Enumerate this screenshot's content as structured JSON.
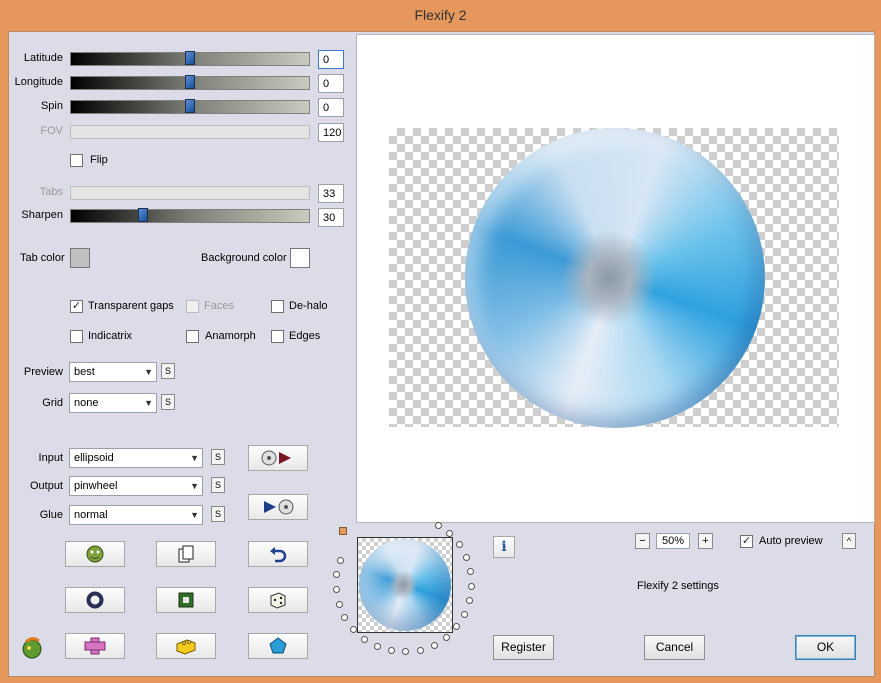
{
  "window": {
    "title": "Flexify 2"
  },
  "sliders": {
    "latitude": {
      "label": "Latitude",
      "value": "0",
      "fraction": 0.5
    },
    "longitude": {
      "label": "Longitude",
      "value": "0",
      "fraction": 0.5
    },
    "spin": {
      "label": "Spin",
      "value": "0",
      "fraction": 0.5
    },
    "fov": {
      "label": "FOV",
      "value": "120"
    },
    "tabs": {
      "label": "Tabs",
      "value": "33"
    },
    "sharpen": {
      "label": "Sharpen",
      "value": "30",
      "fraction": 0.3
    }
  },
  "flip": {
    "label": "Flip",
    "checked": false
  },
  "colors": {
    "tab_color": {
      "label": "Tab color",
      "color": "#c0c0c0"
    },
    "background_color": {
      "label": "Background color",
      "color": "#ffffff"
    }
  },
  "options": {
    "transparent_gaps": {
      "label": "Transparent gaps",
      "checked": true
    },
    "faces": {
      "label": "Faces",
      "checked": false
    },
    "de_halo": {
      "label": "De-halo",
      "checked": false
    },
    "indicatrix": {
      "label": "Indicatrix",
      "checked": false
    },
    "anamorph": {
      "label": "Anamorph",
      "checked": false
    },
    "edges": {
      "label": "Edges",
      "checked": false
    }
  },
  "preview_select": {
    "label": "Preview",
    "value": "best"
  },
  "grid_select": {
    "label": "Grid",
    "value": "none"
  },
  "input_select": {
    "label": "Input",
    "value": "ellipsoid"
  },
  "output_select": {
    "label": "Output",
    "value": "pinwheel"
  },
  "glue_select": {
    "label": "Glue",
    "value": "normal"
  },
  "s_label": "S",
  "check_glyph": "✓",
  "zoom": {
    "minus": "−",
    "value": "50%",
    "plus": "+"
  },
  "auto_preview": {
    "label": "Auto preview",
    "checked": true
  },
  "collapse_glyph": "^",
  "info_glyph": "i",
  "settings_name": "Flexify 2 settings",
  "buttons": {
    "register": "Register",
    "cancel": "Cancel",
    "ok": "OK"
  },
  "theme": {
    "title_bar": "#e6975b",
    "panel": "#dcdce8",
    "accent": "#2fa2df"
  }
}
